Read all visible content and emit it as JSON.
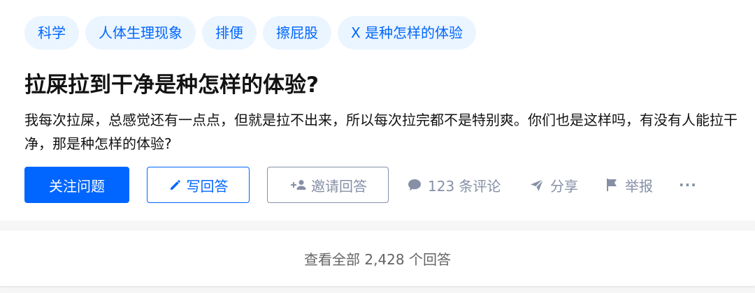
{
  "topics": [
    "科学",
    "人体生理现象",
    "排便",
    "擦屁股",
    "X 是种怎样的体验"
  ],
  "question": {
    "title": "拉屎拉到干净是种怎样的体验?",
    "detail": "我每次拉屎，总感觉还有一点点，但就是拉不出来，所以每次拉完都不是特别爽。你们也是这样吗，有没有人能拉干净，那是种怎样的体验?"
  },
  "actions": {
    "follow_label": "关注问题",
    "answer_label": "写回答",
    "invite_label": "邀请回答",
    "comments_label": "123 条评论",
    "share_label": "分享",
    "report_label": "举报",
    "more_label": "···"
  },
  "view_all_label": "查看全部 2,428 个回答",
  "colors": {
    "brand": "#0066ff",
    "topic_bg": "#ebf5ff",
    "muted": "#8590a6",
    "page_bg": "#f6f6f6"
  },
  "icons": [
    "pencil-icon",
    "add-user-icon",
    "comment-icon",
    "share-icon",
    "flag-icon",
    "more-icon"
  ]
}
